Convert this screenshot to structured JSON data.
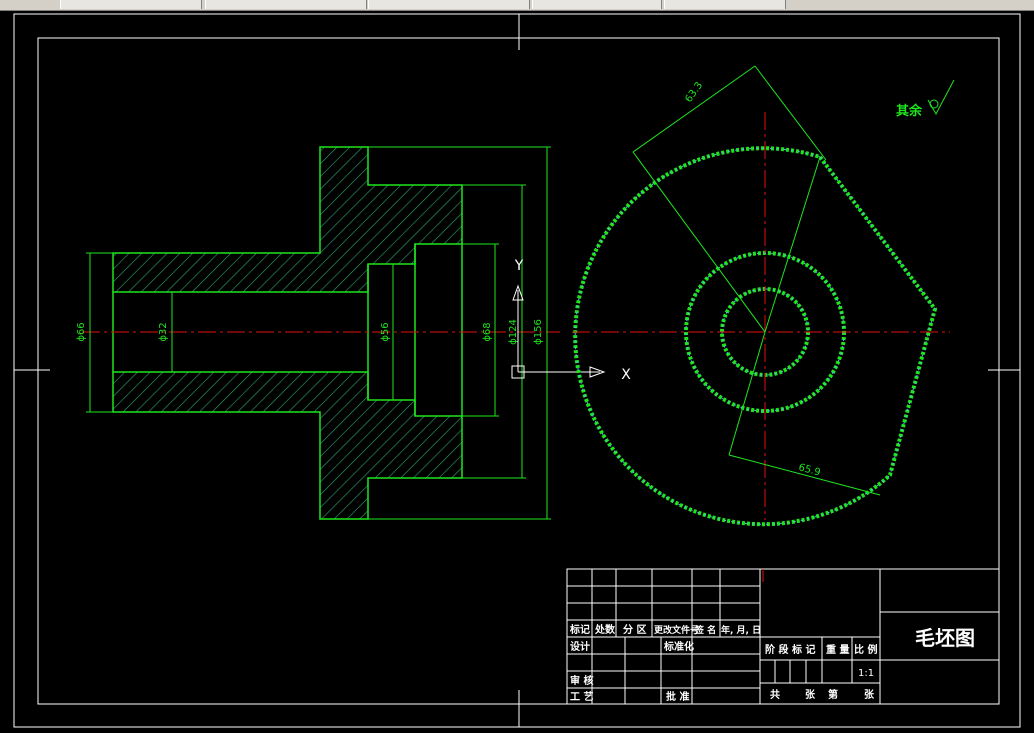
{
  "drawing": {
    "title": "毛坯图",
    "surface_finish_note": "其余",
    "dimensions": {
      "d66": "ϕ66",
      "d32": "ϕ32",
      "d56": "ϕ56",
      "d68": "ϕ68",
      "d124": "ϕ124",
      "d156": "ϕ156",
      "r633": "63.3",
      "r659": "65.9"
    },
    "axis_x_label": "X",
    "axis_y_label": "Y"
  },
  "title_block": {
    "mark": "标记",
    "count": "处数",
    "zone": "分 区",
    "change_doc": "更改文件号",
    "signature": "签 名",
    "date": "年, 月, 日",
    "design": "设计",
    "standardization": "标准化",
    "stage_mark": "阶 段 标 记",
    "weight": "重 量",
    "scale": "比 例",
    "scale_value": "1:1",
    "review": "审 核",
    "process": "工 艺",
    "approve": "批 准",
    "total": "共",
    "sheets": "张",
    "page": "第",
    "sheet": "张"
  },
  "colors": {
    "outline": "#1ee61e",
    "centerline": "#e01010",
    "hatch": "#2fa66a",
    "frame": "#ffffff",
    "dim_text": "#1ee61e"
  }
}
